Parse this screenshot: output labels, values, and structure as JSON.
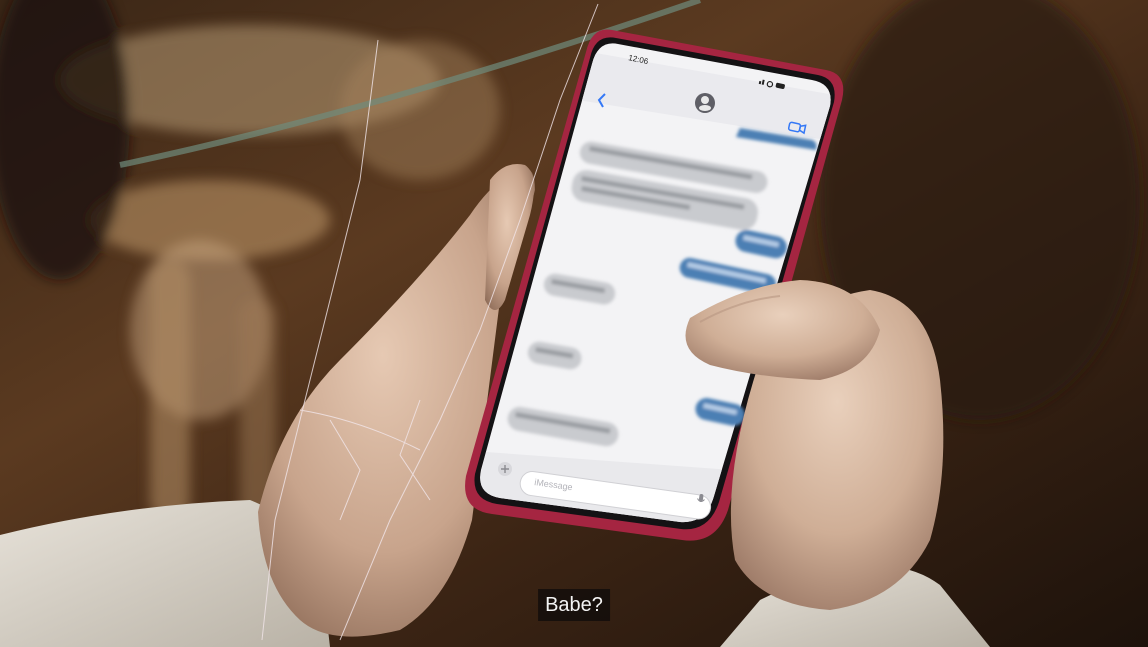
{
  "subtitle": "Babe?",
  "phone": {
    "status_time": "12:06",
    "input_placeholder": "iMessage",
    "case_color": "#a52541"
  },
  "colors": {
    "outgoing_bubble": "#4b7fb4",
    "incoming_bubble": "#c9cbcf",
    "screen_bg": "#f3f3f5"
  }
}
